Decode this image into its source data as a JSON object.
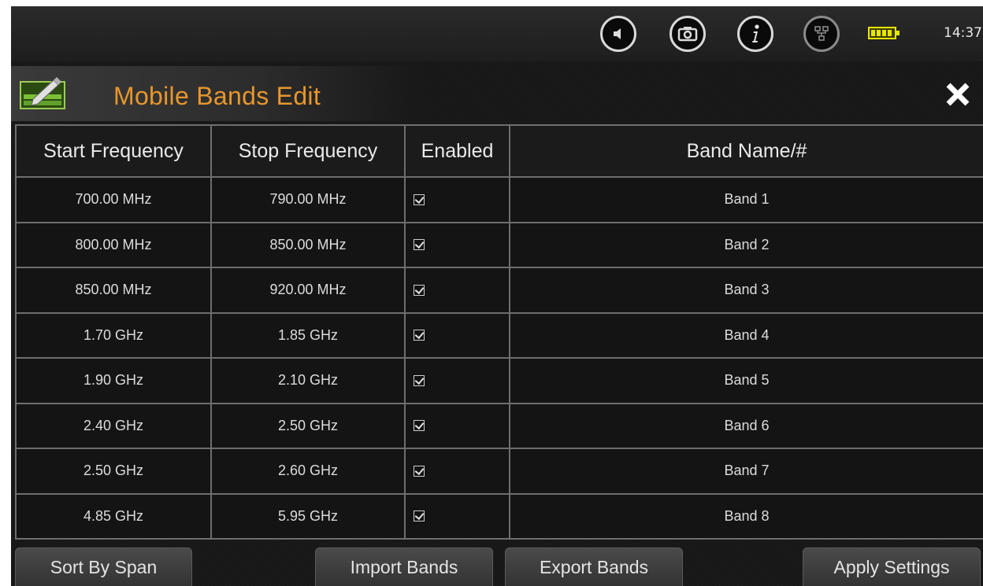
{
  "status_bar": {
    "icons": [
      "speaker-icon",
      "camera-icon",
      "info-icon",
      "network-icon",
      "battery-icon"
    ],
    "time": "14:37",
    "battery_color": "#e6e600"
  },
  "header": {
    "title": "Mobile Bands Edit",
    "title_color": "#e7962d",
    "close_icon": "close-icon"
  },
  "table": {
    "columns": [
      "Start Frequency",
      "Stop Frequency",
      "Enabled",
      "Band Name/#"
    ],
    "rows": [
      {
        "start": "700.00 MHz",
        "stop": "790.00 MHz",
        "enabled": true,
        "name": "Band 1"
      },
      {
        "start": "800.00 MHz",
        "stop": "850.00 MHz",
        "enabled": true,
        "name": "Band 2"
      },
      {
        "start": "850.00 MHz",
        "stop": "920.00 MHz",
        "enabled": true,
        "name": "Band 3"
      },
      {
        "start": "1.70 GHz",
        "stop": "1.85 GHz",
        "enabled": true,
        "name": "Band 4"
      },
      {
        "start": "1.90 GHz",
        "stop": "2.10 GHz",
        "enabled": true,
        "name": "Band 5"
      },
      {
        "start": "2.40 GHz",
        "stop": "2.50 GHz",
        "enabled": true,
        "name": "Band 6"
      },
      {
        "start": "2.50 GHz",
        "stop": "2.60 GHz",
        "enabled": true,
        "name": "Band 7"
      },
      {
        "start": "4.85 GHz",
        "stop": "5.95 GHz",
        "enabled": true,
        "name": "Band 8"
      }
    ]
  },
  "buttons": {
    "sort": "Sort By Span",
    "import": "Import Bands",
    "export": "Export Bands",
    "apply": "Apply Settings"
  }
}
